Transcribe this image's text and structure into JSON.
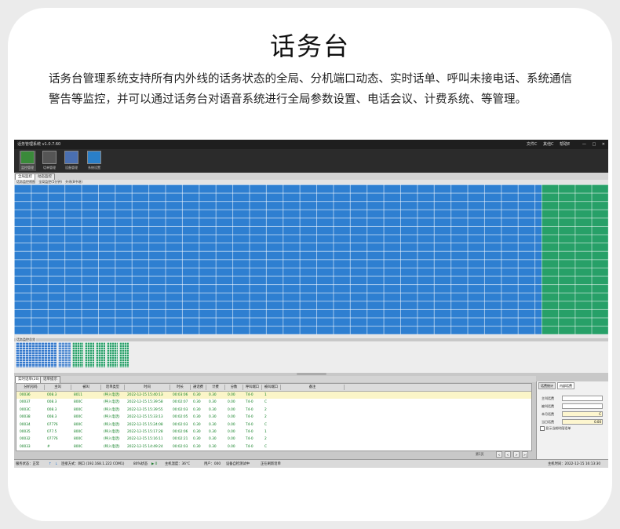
{
  "page": {
    "title": "话务台",
    "description": "话务台管理系统支持所有内外线的话务状态的全局、分机端口动态、实时话单、呼叫未接电话、系统通信警告等监控，并可以通过话务台对语音系统进行全局参数设置、电话会议、计费系统、等管理。"
  },
  "app": {
    "title": "话务管理系统 v1.0.7.60",
    "menus": [
      "文件C",
      "其他C",
      "帮助E"
    ],
    "window_buttons": [
      "—",
      "□",
      "✕"
    ],
    "toolbar": [
      {
        "label": "监控管理",
        "icon": "monitor-icon",
        "color": "#3a8a3a"
      },
      {
        "label": "话单管理",
        "icon": "records-icon",
        "color": "#555555"
      },
      {
        "label": "设备管理",
        "icon": "device-icon",
        "color": "#4a6fb0"
      },
      {
        "label": "系统设置",
        "icon": "settings-icon",
        "color": "#2a7fc8"
      }
    ],
    "tabs": [
      "全局监控",
      "动态监控"
    ],
    "sub_labels": [
      "话务监控视图",
      "全局监控(5分钟)",
      "外线(8中继)"
    ],
    "overview_label": "话务监控总览",
    "bottom_tabs": [
      "实时话单(20)",
      "话单提示"
    ],
    "table": {
      "columns": [
        "分机号码",
        "主叫",
        "被叫",
        "话单类型",
        "时间",
        "时长",
        "通话费",
        "计费",
        "分数",
        "呼叫端口",
        "被叫端口",
        "备注"
      ],
      "rows": [
        [
          "00036",
          "008.3",
          "8011",
          "(呼入电话)",
          "2022-12-15 15:40:13",
          "00:03:06",
          "0.30",
          "0.30",
          "0.00",
          "T4-0",
          "1",
          ""
        ],
        [
          "00037",
          "008.3",
          "800C",
          "(呼入电话)",
          "2022-12-15 15:39:58",
          "00:02:07",
          "0.30",
          "0.30",
          "0.00",
          "T4-0",
          "C",
          ""
        ],
        [
          "0003C",
          "008.3",
          "800C",
          "(呼入电话)",
          "2022-12-15 15:39:55",
          "00:02:03",
          "0.30",
          "0.30",
          "0.00",
          "T4-0",
          "2",
          ""
        ],
        [
          "00038",
          "008.3",
          "800C",
          "(呼入电话)",
          "2022-12-15 15:33:13",
          "00:02:05",
          "0.30",
          "0.30",
          "0.00",
          "T4-0",
          "2",
          ""
        ],
        [
          "00034",
          "07776",
          "800C",
          "(呼入电话)",
          "2022-12-15 15:24:08",
          "00:02:03",
          "0.30",
          "0.30",
          "0.00",
          "T4-0",
          "C",
          ""
        ],
        [
          "00035",
          "077.5",
          "800C",
          "(呼入电话)",
          "2022-12-15 15:17:28",
          "00:02:06",
          "0.30",
          "0.30",
          "0.00",
          "T4-0",
          "1",
          ""
        ],
        [
          "00032",
          "07776",
          "800C",
          "(呼入电话)",
          "2022-12-15 15:16:11",
          "00:02:21",
          "0.30",
          "0.30",
          "0.00",
          "T4-0",
          "2",
          ""
        ],
        [
          "00033",
          "#",
          "800C",
          "(呼入电话)",
          "2022-12-15 14:49:24",
          "00:02:03",
          "0.30",
          "0.30",
          "0.00",
          "T4-0",
          "C",
          ""
        ]
      ]
    },
    "pager": {
      "label": "第1页",
      "buttons": [
        "<",
        "<",
        ">",
        ">|"
      ]
    },
    "right_panel": {
      "tabs": [
        "话费统计",
        "内部话费"
      ],
      "fields": [
        {
          "label": "主叫话费",
          "value": ""
        },
        {
          "label": "被叫话费",
          "value": ""
        },
        {
          "label": "本月话费",
          "value": "C"
        },
        {
          "label": "当日话费",
          "value": "0.00"
        }
      ],
      "checkbox_label": "显示当前时段话单"
    },
    "status": [
      "服务状态：正常",
      "↑",
      "↓",
      "连接方式：网口 (192.168.1.222 COM1)",
      "80%状态",
      "▶ 0",
      "主机温度：36°C",
      "用户：000",
      "设备自检测试中",
      "正在刷新话单",
      "主机时间：2022-12-15 16:13:30"
    ]
  }
}
